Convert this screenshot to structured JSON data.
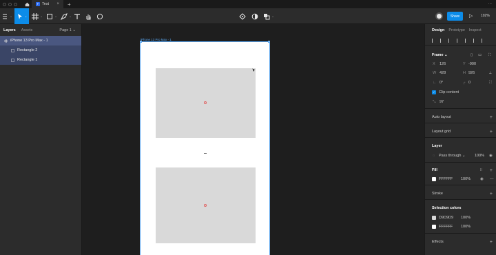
{
  "titlebar": {
    "tab_title": "Test",
    "tab_logo": "F",
    "new_tab": "+",
    "more": "···"
  },
  "toolbar": {
    "share_label": "Share",
    "zoom": "102%",
    "icons": [
      "main-menu-icon",
      "move-tool-icon",
      "frame-tool-icon",
      "shape-tool-icon",
      "pen-tool-icon",
      "text-tool-icon",
      "hand-tool-icon",
      "comment-icon",
      "component-icon",
      "mask-icon",
      "boolean-icon",
      "play-icon"
    ]
  },
  "left_panel": {
    "tabs": [
      "Layers",
      "Assets"
    ],
    "page": "Page 1 ⌄",
    "layers": [
      {
        "name": "iPhone 13 Pro Max - 1",
        "kind": "frame"
      },
      {
        "name": "Rectangle 2",
        "kind": "rectangle"
      },
      {
        "name": "Rectangle 1",
        "kind": "rectangle"
      }
    ]
  },
  "canvas": {
    "frame_label": "iPhone 13 Pro Max - 1",
    "frame_fill": "#FFFFFF",
    "rect_fill": "#D9D9D9",
    "selection_color": "#5AA6F0"
  },
  "right_panel": {
    "tabs": [
      "Design",
      "Prototype",
      "Inspect"
    ],
    "frame": {
      "title": "Frame ⌄",
      "x_label": "X",
      "x": "126",
      "y_label": "Y",
      "y": "-900",
      "w_label": "W",
      "w": "428",
      "h_label": "H",
      "h": "926",
      "rotation": "0°",
      "radius": "0",
      "clip_content": "Clip content",
      "extra_value": "97"
    },
    "sections": {
      "auto_layout": "Auto layout",
      "layout_grid": "Layout grid",
      "layer": "Layer",
      "fill": "Fill",
      "stroke": "Stroke",
      "selection_colors": "Selection colors",
      "effects": "Effects"
    },
    "layer": {
      "blend": "Pass through ⌄",
      "opacity": "100%"
    },
    "fill": {
      "hex": "FFFFFF",
      "opacity": "100%",
      "color": "#FFFFFF"
    },
    "selection_colors": [
      {
        "hex": "D9D9D9",
        "opacity": "100%",
        "color": "#D9D9D9"
      },
      {
        "hex": "FFFFFF",
        "opacity": "100%",
        "color": "#FFFFFF"
      }
    ]
  },
  "colors": {
    "accent": "#0C8CE9",
    "panel": "#2C2C2C",
    "canvas": "#1E1E1E"
  }
}
